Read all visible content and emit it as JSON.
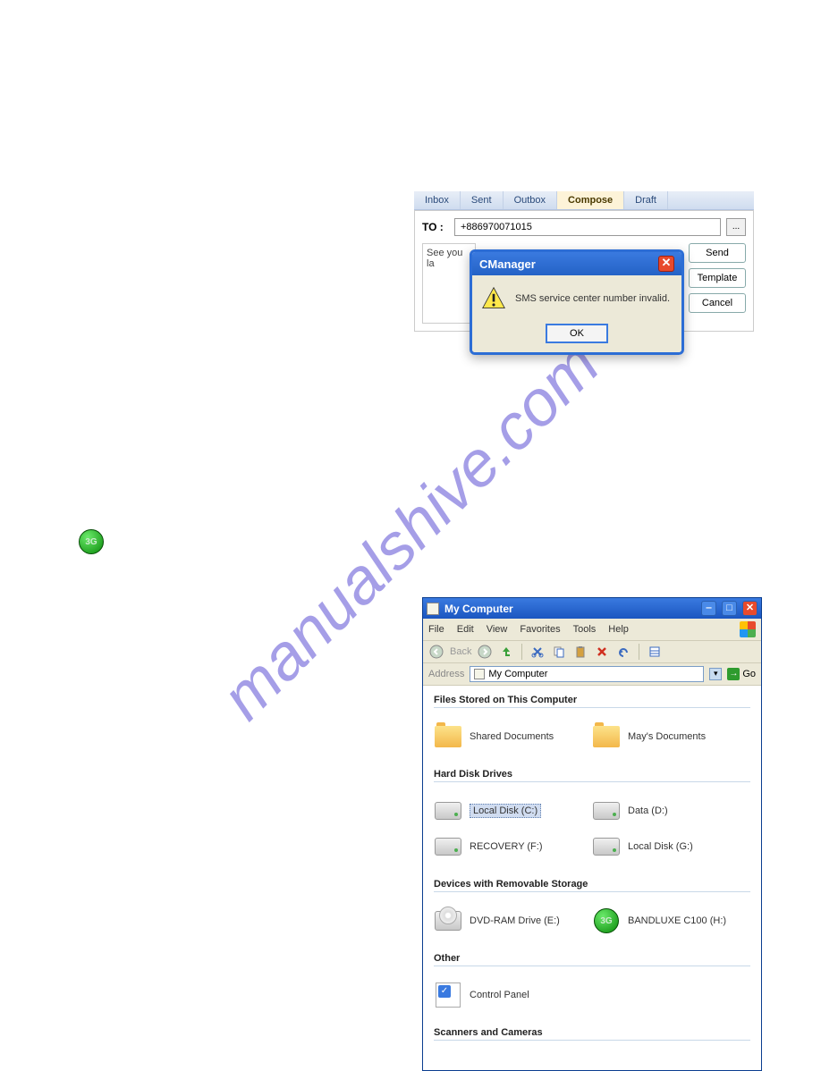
{
  "watermark": "manualshive.com",
  "compose": {
    "tabs": [
      "Inbox",
      "Sent",
      "Outbox",
      "Compose",
      "Draft"
    ],
    "to_label": "TO :",
    "to_value": "+886970071015",
    "contacts_btn": "...",
    "msg_text": "See you la",
    "buttons": [
      "Send",
      "Template",
      "Cancel"
    ]
  },
  "dialog": {
    "title": "CManager",
    "message": "SMS service center number invalid.",
    "ok": "OK"
  },
  "icon3g": {
    "label": "3G"
  },
  "mycomputer": {
    "title": "My Computer",
    "menu": [
      "File",
      "Edit",
      "View",
      "Favorites",
      "Tools",
      "Help"
    ],
    "toolbar": {
      "back": "Back"
    },
    "address_label": "Address",
    "address_value": "My Computer",
    "go": "Go",
    "sections": [
      {
        "header": "Files Stored on This Computer",
        "items": [
          "Shared Documents",
          "May's Documents"
        ]
      },
      {
        "header": "Hard Disk Drives",
        "items": [
          "Local Disk (C:)",
          "Data (D:)",
          "RECOVERY (F:)",
          "Local Disk (G:)"
        ]
      },
      {
        "header": "Devices with Removable Storage",
        "items": [
          "DVD-RAM Drive (E:)",
          "BANDLUXE C100 (H:)"
        ]
      },
      {
        "header": "Other",
        "items": [
          "Control Panel"
        ]
      },
      {
        "header": "Scanners and Cameras",
        "items": []
      }
    ]
  }
}
